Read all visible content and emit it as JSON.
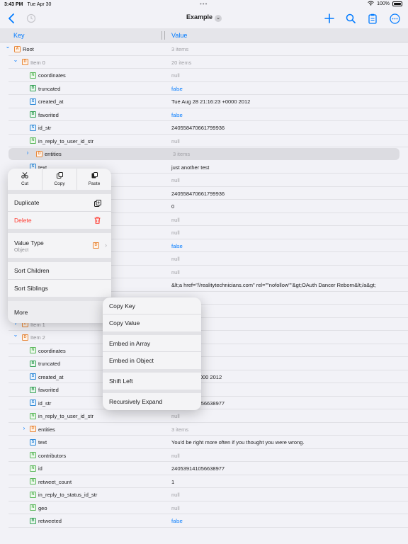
{
  "status": {
    "time": "3:43 PM",
    "date": "Tue Apr 30",
    "battery": "100%"
  },
  "nav": {
    "title": "Example"
  },
  "header": {
    "key": "Key",
    "value": "Value"
  },
  "rows": [
    {
      "indent": 0,
      "disc": "open",
      "badge": "A",
      "key": "Root",
      "val": "3 items",
      "valstyle": "muted",
      "keystyle": ""
    },
    {
      "indent": 1,
      "disc": "open",
      "badge": "D",
      "key": "Item 0",
      "val": "20 items",
      "valstyle": "muted",
      "keystyle": "gray-key"
    },
    {
      "indent": 2,
      "disc": "",
      "badge": "N",
      "key": "coordinates",
      "val": "null",
      "valstyle": "muted",
      "keystyle": ""
    },
    {
      "indent": 2,
      "disc": "",
      "badge": "B",
      "key": "truncated",
      "val": "false",
      "valstyle": "blue",
      "keystyle": ""
    },
    {
      "indent": 2,
      "disc": "",
      "badge": "S",
      "key": "created_at",
      "val": "Tue Aug 28 21:16:23 +0000 2012",
      "valstyle": "",
      "keystyle": ""
    },
    {
      "indent": 2,
      "disc": "",
      "badge": "B",
      "key": "favorited",
      "val": "false",
      "valstyle": "blue",
      "keystyle": ""
    },
    {
      "indent": 2,
      "disc": "",
      "badge": "S",
      "key": "id_str",
      "val": "240558470661799936",
      "valstyle": "",
      "keystyle": ""
    },
    {
      "indent": 2,
      "disc": "",
      "badge": "N",
      "key": "in_reply_to_user_id_str",
      "val": "null",
      "valstyle": "muted",
      "keystyle": ""
    },
    {
      "indent": 2,
      "disc": "closed",
      "badge": "D",
      "key": "entities",
      "val": "3 items",
      "valstyle": "muted",
      "keystyle": "",
      "highlight": true
    },
    {
      "indent": 2,
      "disc": "",
      "badge": "S",
      "key": "text",
      "val": "just another test",
      "valstyle": "",
      "keystyle": ""
    },
    {
      "indent": 2,
      "disc": "",
      "badge": "N",
      "key": "",
      "val": "null",
      "valstyle": "muted",
      "keystyle": ""
    },
    {
      "indent": 2,
      "disc": "",
      "badge": "N",
      "key": "",
      "val": "240558470661799936",
      "valstyle": "",
      "keystyle": ""
    },
    {
      "indent": 2,
      "disc": "",
      "badge": "N",
      "key": "",
      "val": "0",
      "valstyle": "",
      "keystyle": ""
    },
    {
      "indent": 2,
      "disc": "",
      "badge": "N",
      "key": "",
      "val": "null",
      "valstyle": "muted",
      "keystyle": ""
    },
    {
      "indent": 2,
      "disc": "",
      "badge": "N",
      "key": "",
      "val": "null",
      "valstyle": "muted",
      "keystyle": ""
    },
    {
      "indent": 2,
      "disc": "",
      "badge": "B",
      "key": "",
      "val": "false",
      "valstyle": "blue",
      "keystyle": ""
    },
    {
      "indent": 2,
      "disc": "",
      "badge": "N",
      "key": "",
      "val": "null",
      "valstyle": "muted",
      "keystyle": ""
    },
    {
      "indent": 2,
      "disc": "",
      "badge": "N",
      "key": "",
      "val": "null",
      "valstyle": "muted",
      "keystyle": ""
    },
    {
      "indent": 2,
      "disc": "",
      "badge": "S",
      "key": "",
      "val": "&lt;a href=\"//realitytechnicians.com\" rel=\"\"nofollow\"\"&gt;OAuth Dancer Reborn&lt;/a&gt;",
      "valstyle": "",
      "keystyle": ""
    },
    {
      "indent": 2,
      "disc": "",
      "badge": "N",
      "key": "",
      "val": "",
      "valstyle": "muted",
      "keystyle": ""
    },
    {
      "indent": 2,
      "disc": "",
      "badge": "N",
      "key": "in_reply_to_status_id",
      "val": "",
      "valstyle": "muted",
      "keystyle": ""
    },
    {
      "indent": 1,
      "disc": "closed",
      "badge": "D",
      "key": "Item 1",
      "val": "",
      "valstyle": "muted",
      "keystyle": "gray-key"
    },
    {
      "indent": 1,
      "disc": "open",
      "badge": "D",
      "key": "Item 2",
      "val": "",
      "valstyle": "muted",
      "keystyle": "gray-key"
    },
    {
      "indent": 2,
      "disc": "",
      "badge": "N",
      "key": "coordinates",
      "val": "",
      "valstyle": "muted",
      "keystyle": ""
    },
    {
      "indent": 2,
      "disc": "",
      "badge": "B",
      "key": "truncated",
      "val": "",
      "valstyle": "blue",
      "keystyle": ""
    },
    {
      "indent": 2,
      "disc": "",
      "badge": "S",
      "key": "created_at",
      "val": "19:59:34 +0000 2012",
      "valstyle": "",
      "keystyle": "",
      "valshift": true
    },
    {
      "indent": 2,
      "disc": "",
      "badge": "B",
      "key": "favorited",
      "val": "",
      "valstyle": "blue",
      "keystyle": ""
    },
    {
      "indent": 2,
      "disc": "",
      "badge": "S",
      "key": "id_str",
      "val": "240539141056638977",
      "valstyle": "",
      "keystyle": ""
    },
    {
      "indent": 2,
      "disc": "",
      "badge": "N",
      "key": "in_reply_to_user_id_str",
      "val": "null",
      "valstyle": "muted",
      "keystyle": ""
    },
    {
      "indent": 2,
      "disc": "closed",
      "badge": "D",
      "key": "entities",
      "val": "3 items",
      "valstyle": "muted",
      "keystyle": ""
    },
    {
      "indent": 2,
      "disc": "",
      "badge": "S",
      "key": "text",
      "val": "You'd be right more often if you thought you were wrong.",
      "valstyle": "",
      "keystyle": ""
    },
    {
      "indent": 2,
      "disc": "",
      "badge": "N",
      "key": "contributors",
      "val": "null",
      "valstyle": "muted",
      "keystyle": ""
    },
    {
      "indent": 2,
      "disc": "",
      "badge": "N",
      "key": "id",
      "val": "240539141056638977",
      "valstyle": "",
      "keystyle": ""
    },
    {
      "indent": 2,
      "disc": "",
      "badge": "N",
      "key": "retweet_count",
      "val": "1",
      "valstyle": "",
      "keystyle": ""
    },
    {
      "indent": 2,
      "disc": "",
      "badge": "N",
      "key": "in_reply_to_status_id_str",
      "val": "null",
      "valstyle": "muted",
      "keystyle": ""
    },
    {
      "indent": 2,
      "disc": "",
      "badge": "N",
      "key": "geo",
      "val": "null",
      "valstyle": "muted",
      "keystyle": ""
    },
    {
      "indent": 2,
      "disc": "",
      "badge": "B",
      "key": "retweeted",
      "val": "false",
      "valstyle": "blue",
      "keystyle": ""
    }
  ],
  "menu": {
    "cut": "Cut",
    "copy": "Copy",
    "paste": "Paste",
    "duplicate": "Duplicate",
    "delete": "Delete",
    "value_type": "Value Type",
    "value_type_sub": "Object",
    "value_type_badge": "D",
    "sort_children": "Sort Children",
    "sort_siblings": "Sort Siblings",
    "more": "More"
  },
  "submenu": {
    "copy_key": "Copy Key",
    "copy_value": "Copy Value",
    "embed_array": "Embed in Array",
    "embed_object": "Embed in Object",
    "shift_left": "Shift Left",
    "recursively_expand": "Recursively Expand"
  },
  "colors": {
    "accent": "#007aff",
    "destructive": "#ff3b30"
  }
}
